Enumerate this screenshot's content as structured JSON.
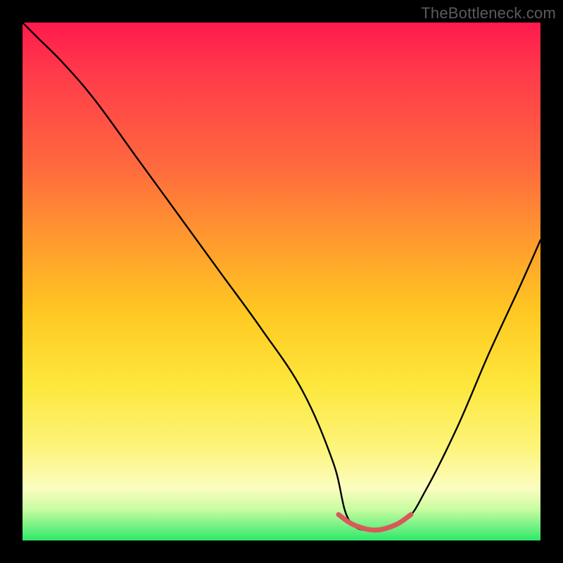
{
  "watermark": {
    "text": "TheBottleneck.com"
  },
  "colors": {
    "frame": "#000000",
    "curve_stroke": "#000000",
    "highlight_stroke": "#d75a5a",
    "gradient_stops": [
      "#ff1a4d",
      "#ff3b4a",
      "#ff6a3e",
      "#ff9a2e",
      "#ffc822",
      "#fde73c",
      "#fdf47a",
      "#fbfdc0",
      "#c8fca0",
      "#2ee86b"
    ]
  },
  "chart_data": {
    "type": "line",
    "title": "",
    "xlabel": "",
    "ylabel": "",
    "x_range": [
      0,
      100
    ],
    "y_range": [
      0,
      100
    ],
    "note": "x/y are percentages across the plot area (0=left/bottom, 100=right/top). The single series traces a V-shaped bottleneck curve with a flat optimum segment near x≈63–74 at y≈2. A separate highlight segment marks that optimum in a salmon color.",
    "series": [
      {
        "name": "bottleneck-curve",
        "x": [
          0,
          3,
          8,
          14,
          22,
          30,
          38,
          46,
          54,
          60,
          63,
          68,
          74,
          78,
          84,
          90,
          96,
          100
        ],
        "y": [
          100,
          97,
          92,
          85,
          74,
          63,
          52,
          41,
          29,
          15,
          4,
          2,
          4,
          10,
          22,
          36,
          49,
          58
        ]
      }
    ],
    "highlight_segment": {
      "name": "optimum-band",
      "x": [
        61,
        64,
        68,
        72,
        75
      ],
      "y": [
        5,
        3,
        2,
        3,
        5
      ]
    }
  }
}
